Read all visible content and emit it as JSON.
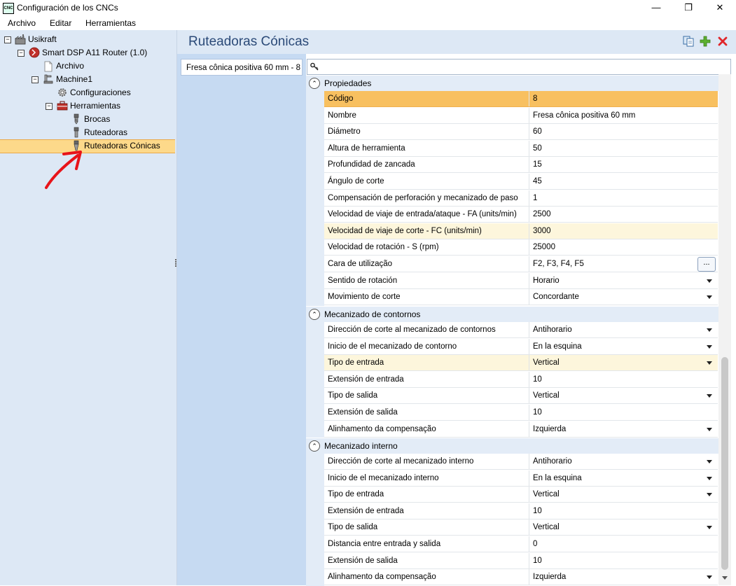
{
  "window": {
    "title": "Configuración de los CNCs",
    "app_icon_text": "CNC",
    "controls": [
      "minimize-icon",
      "restore-icon",
      "close-icon"
    ]
  },
  "menu": [
    "Archivo",
    "Editar",
    "Herramientas"
  ],
  "tree": [
    {
      "label": "Usikraft",
      "level": 0,
      "expanded": true,
      "icon": "factory-icon"
    },
    {
      "label": "Smart DSP A11 Router (1.0)",
      "level": 1,
      "expanded": true,
      "icon": "router-icon"
    },
    {
      "label": "Archivo",
      "level": 2,
      "icon": "file-icon"
    },
    {
      "label": "Machine1",
      "level": 2,
      "expanded": true,
      "icon": "machine-icon"
    },
    {
      "label": "Configuraciones",
      "level": 3,
      "icon": "gear-icon"
    },
    {
      "label": "Herramientas",
      "level": 3,
      "expanded": true,
      "icon": "toolbox-icon"
    },
    {
      "label": "Brocas",
      "level": 4,
      "icon": "drill-bit-icon"
    },
    {
      "label": "Ruteadoras",
      "level": 4,
      "icon": "router-bit-icon"
    },
    {
      "label": "Ruteadoras Cónicas",
      "level": 4,
      "icon": "conical-bit-icon",
      "selected": true
    }
  ],
  "panel": {
    "title": "Ruteadoras Cónicas",
    "header_icons": [
      "copy-icon",
      "add-icon",
      "delete-icon"
    ]
  },
  "tool_list": [
    "Fresa cônica positiva 60 mm - 8"
  ],
  "search": {
    "value": "",
    "icon": "key-icon"
  },
  "sections": [
    {
      "title": "Propiedades",
      "rows": [
        {
          "name": "Código",
          "value": "8",
          "focused": true
        },
        {
          "name": "Nombre",
          "value": "Fresa cônica positiva 60 mm"
        },
        {
          "name": "Diámetro",
          "value": "60"
        },
        {
          "name": "Altura de herramienta",
          "value": "50"
        },
        {
          "name": "Profundidad de zancada",
          "value": "15"
        },
        {
          "name": "Ángulo de corte",
          "value": "45"
        },
        {
          "name": "Compensación de perforación y mecanizado de paso",
          "value": "1"
        },
        {
          "name": "Velocidad de viaje de entrada/ataque - FA (units/min)",
          "value": "2500"
        },
        {
          "name": "Velocidad de viaje de corte - FC (units/min)",
          "value": "3000",
          "highlight": true
        },
        {
          "name": "Velocidad de rotación - S (rpm)",
          "value": "25000"
        },
        {
          "name": "Cara de utilização",
          "value": "F2, F3, F4, F5",
          "ellipsis": "..."
        },
        {
          "name": "Sentido de rotación",
          "value": "Horario",
          "dropdown": true
        },
        {
          "name": "Movimiento de corte",
          "value": "Concordante",
          "dropdown": true
        }
      ]
    },
    {
      "title": "Mecanizado de contornos",
      "rows": [
        {
          "name": "Dirección de corte al mecanizado de contornos",
          "value": "Antihorario",
          "dropdown": true
        },
        {
          "name": "Inicio de el mecanizado de contorno",
          "value": "En la esquina",
          "dropdown": true
        },
        {
          "name": "Tipo de entrada",
          "value": "Vertical",
          "dropdown": true,
          "highlight": true
        },
        {
          "name": "Extensión de entrada",
          "value": "10"
        },
        {
          "name": "Tipo de salida",
          "value": "Vertical",
          "dropdown": true
        },
        {
          "name": "Extensión de salida",
          "value": "10"
        },
        {
          "name": "Alinhamento da compensação",
          "value": "Izquierda",
          "dropdown": true
        }
      ]
    },
    {
      "title": "Mecanizado interno",
      "rows": [
        {
          "name": "Dirección de corte al mecanizado interno",
          "value": "Antihorario",
          "dropdown": true
        },
        {
          "name": "Inicio de el mecanizado interno",
          "value": "En la esquina",
          "dropdown": true
        },
        {
          "name": "Tipo de entrada",
          "value": "Vertical",
          "dropdown": true
        },
        {
          "name": "Extensión de entrada",
          "value": "10"
        },
        {
          "name": "Tipo de salida",
          "value": "Vertical",
          "dropdown": true
        },
        {
          "name": "Distancia entre entrada y salida",
          "value": "0"
        },
        {
          "name": "Extensión de salida",
          "value": "10"
        },
        {
          "name": "Alinhamento da compensação",
          "value": "Izquierda",
          "dropdown": true
        }
      ]
    }
  ]
}
